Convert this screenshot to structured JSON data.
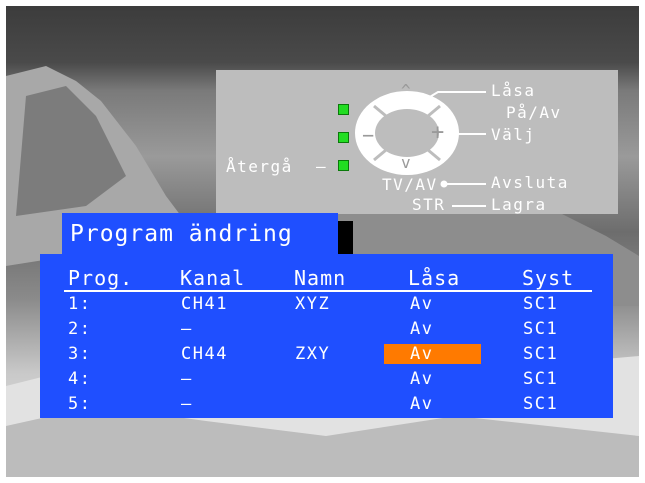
{
  "help": {
    "lock_label": "Låsa",
    "on_off_label": "På/Av",
    "select_label": "Välj",
    "back_label": "Återgå",
    "tvav_label": "TV/AV",
    "exit_label": "Avsluta",
    "str_label": "STR",
    "store_label": "Lagra",
    "up_glyph": "^",
    "down_glyph": "v",
    "minus_glyph": "−",
    "plus_glyph": "+",
    "dash": "–",
    "led_color": "#22dd22"
  },
  "title": "Program ändring",
  "table": {
    "headers": [
      "Prog.",
      "Kanal",
      "Namn",
      "Låsa",
      "Syst"
    ],
    "rows": [
      {
        "prog": "1:",
        "kanal": "CH41",
        "namn": "XYZ",
        "lasa": "Av",
        "syst": "SC1",
        "selected": false
      },
      {
        "prog": "2:",
        "kanal": "–",
        "namn": "",
        "lasa": "Av",
        "syst": "SC1",
        "selected": false
      },
      {
        "prog": "3:",
        "kanal": "CH44",
        "namn": "ZXY",
        "lasa": "Av",
        "syst": "SC1",
        "selected": true
      },
      {
        "prog": "4:",
        "kanal": "–",
        "namn": "",
        "lasa": "Av",
        "syst": "SC1",
        "selected": false
      },
      {
        "prog": "5:",
        "kanal": "–",
        "namn": "",
        "lasa": "Av",
        "syst": "SC1",
        "selected": false
      }
    ]
  },
  "colors": {
    "osd_blue": "#1f4fff",
    "highlight": "#ff7a00",
    "panel_grey": "#bdbdbd"
  }
}
